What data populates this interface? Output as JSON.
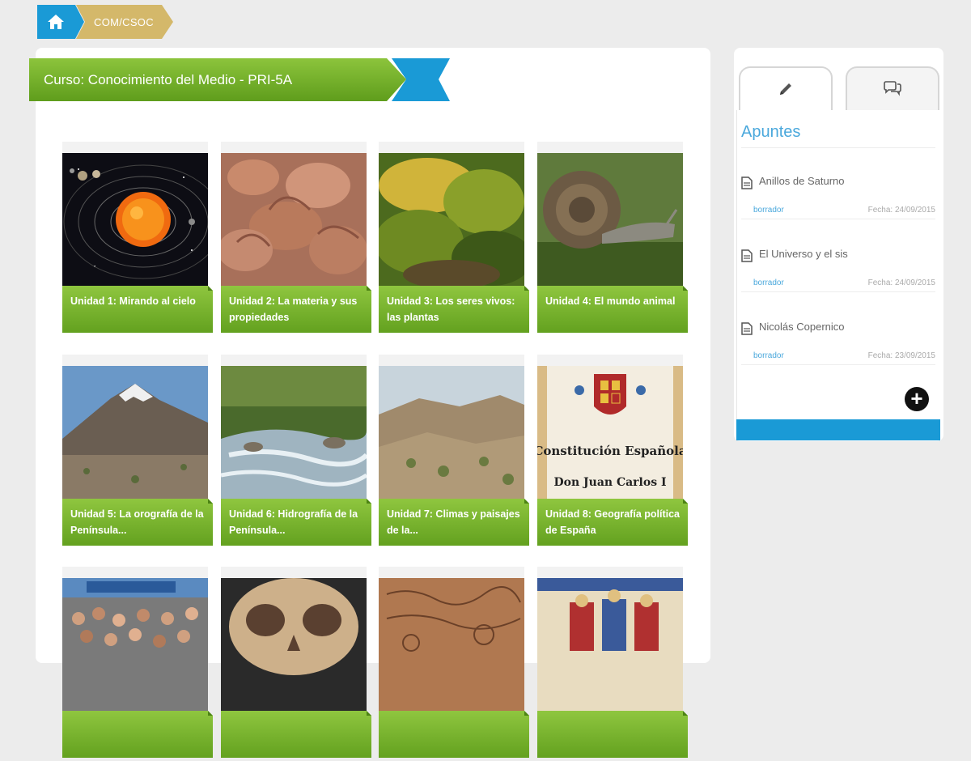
{
  "breadcrumb": {
    "home_icon": "home-icon",
    "course_code": "COM/CSOC"
  },
  "course": {
    "title": "Curso: Conocimiento del Medio - PRI-5A"
  },
  "units": [
    {
      "label": "Unidad 1: Mirando al cielo"
    },
    {
      "label": "Unidad 2: La materia y sus propiedades"
    },
    {
      "label": "Unidad 3: Los seres vivos: las plantas"
    },
    {
      "label": "Unidad 4: El mundo animal"
    },
    {
      "label": "Unidad 5: La orografía de la Península..."
    },
    {
      "label": "Unidad 6: Hidrografía de la Península..."
    },
    {
      "label": "Unidad 7: Climas y paisajes de la..."
    },
    {
      "label": "Unidad 8: Geografía política de España"
    },
    {
      "label": ""
    },
    {
      "label": ""
    },
    {
      "label": ""
    },
    {
      "label": ""
    }
  ],
  "thumb_text": {
    "constitution_line1": "Constitución Española",
    "constitution_line2": "Don Juan Carlos I"
  },
  "sidebar": {
    "tabs": [
      {
        "icon": "pencil-icon"
      },
      {
        "icon": "chat-icon"
      }
    ],
    "title": "Apuntes",
    "notes": [
      {
        "title": "Anillos de Saturno",
        "status": "borrador",
        "date": "Fecha: 24/09/2015"
      },
      {
        "title": "El Universo y el sis",
        "status": "borrador",
        "date": "Fecha: 24/09/2015"
      },
      {
        "title": "Nicolás Copernico",
        "status": "borrador",
        "date": "Fecha: 23/09/2015"
      }
    ],
    "add_icon": "plus-icon"
  },
  "colors": {
    "blue": "#1a9ad6",
    "green": "#7ab52e",
    "gold": "#d4b86a"
  }
}
